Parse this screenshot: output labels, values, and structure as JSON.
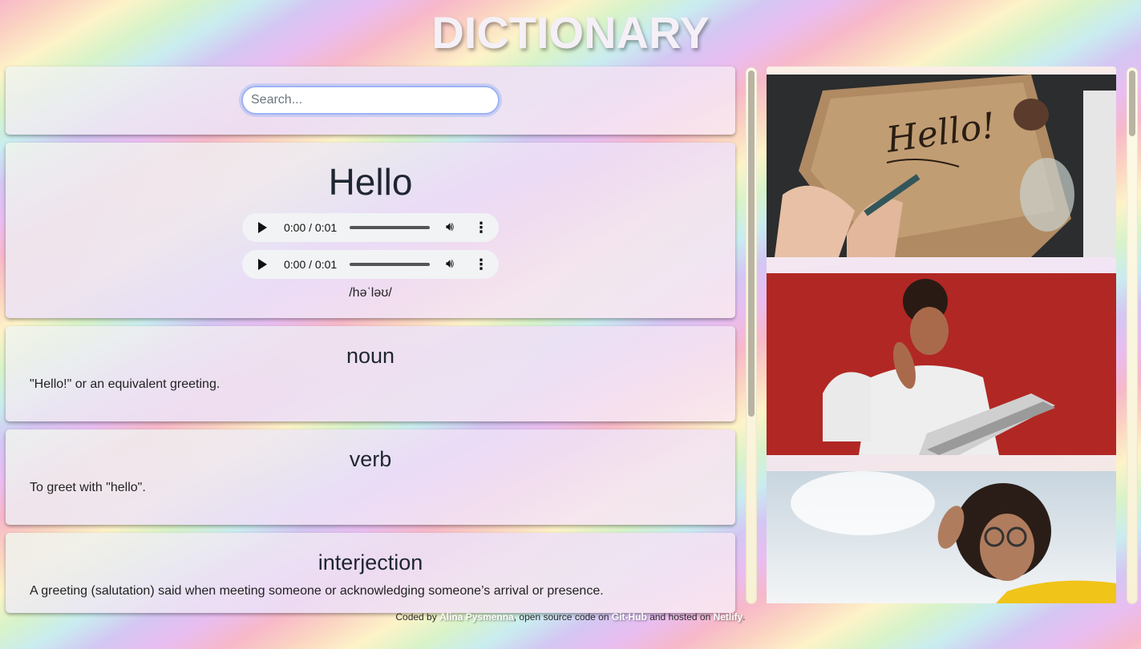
{
  "app": {
    "title": "DICTIONARY"
  },
  "search": {
    "placeholder": "Search...",
    "value": ""
  },
  "word": {
    "text": "Hello",
    "phonetic": "/həˈləʊ/",
    "audio": [
      {
        "time": "0:00 / 0:01"
      },
      {
        "time": "0:00 / 0:01"
      }
    ]
  },
  "meanings": [
    {
      "part_of_speech": "noun",
      "definition": "\"Hello!\" or an equivalent greeting."
    },
    {
      "part_of_speech": "verb",
      "definition": "To greet with \"hello\"."
    },
    {
      "part_of_speech": "interjection",
      "definition": "A greeting (salutation) said when meeting someone or acknowledging someone’s arrival or presence."
    }
  ],
  "photos": [
    {
      "icon": "photo-handwritten-hello-image"
    },
    {
      "icon": "photo-man-waving-laptop-image"
    },
    {
      "icon": "photo-woman-waving-image"
    }
  ],
  "footer": {
    "prefix": "Coded by ",
    "author": "Alina Pysmenna",
    "middle": ", open source code on ",
    "github": "Git-Hub",
    "suffix": " and hosted on ",
    "host": "Netlify",
    "end": "."
  }
}
